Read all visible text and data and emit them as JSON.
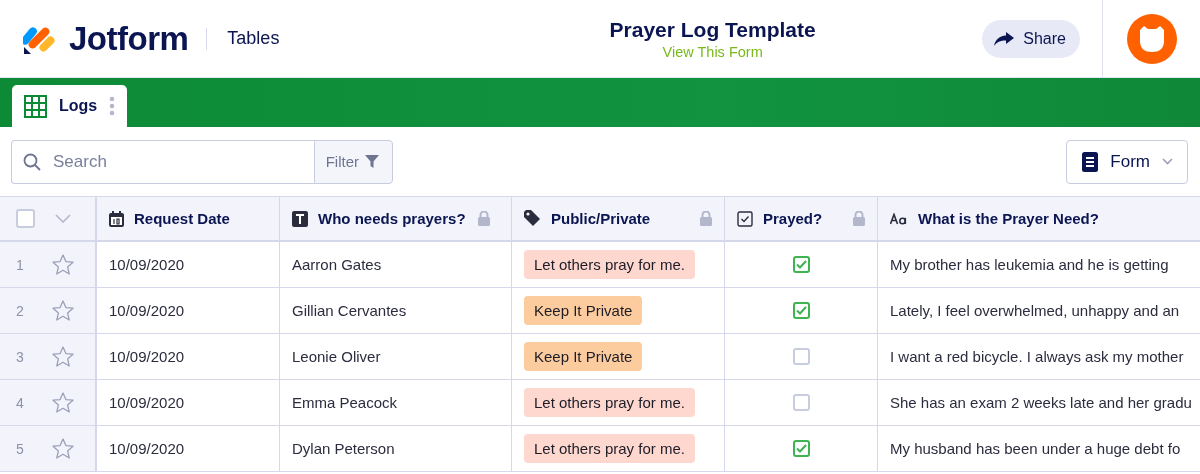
{
  "header": {
    "brand": "Jotform",
    "section": "Tables",
    "title": "Prayer Log Template",
    "form_link": "View This Form",
    "share": "Share"
  },
  "tabs": [
    {
      "label": "Logs",
      "selected": true
    }
  ],
  "toolbar": {
    "search_placeholder": "Search",
    "filter": "Filter",
    "view": "Form"
  },
  "table": {
    "select_all_checked": false,
    "columns": [
      {
        "label": "Request Date",
        "kind": "date",
        "locked": false
      },
      {
        "label": "Who needs prayers?",
        "kind": "text",
        "locked": true
      },
      {
        "label": "Public/Private",
        "kind": "tag",
        "locked": true
      },
      {
        "label": "Prayed?",
        "kind": "checkbox",
        "locked": true
      },
      {
        "label": "What is the Prayer Need?",
        "kind": "longtext",
        "locked": false
      }
    ],
    "rows": [
      {
        "number": "1",
        "starred": false,
        "date": "10/09/2020",
        "name": "Aarron Gates",
        "tag": "Let others pray for me.",
        "color": "#fed7cf",
        "prayed": true,
        "need": "My brother has leukemia and he is getting"
      },
      {
        "number": "2",
        "starred": false,
        "date": "10/09/2020",
        "name": "Gillian Cervantes",
        "tag": "Keep It Private",
        "color": "#fdcc9e",
        "prayed": true,
        "need": "Lately, I feel overwhelmed, unhappy and an"
      },
      {
        "number": "3",
        "starred": false,
        "date": "10/09/2020",
        "name": "Leonie Oliver",
        "tag": "Keep It Private",
        "color": "#fdcc9e",
        "prayed": false,
        "need": "I want a red bicycle. I always ask my mother"
      },
      {
        "number": "4",
        "starred": false,
        "date": "10/09/2020",
        "name": "Emma Peacock",
        "tag": "Let others pray for me.",
        "color": "#fed7cf",
        "prayed": false,
        "need": "She has an exam 2 weeks late and her gradu"
      },
      {
        "number": "5",
        "starred": false,
        "date": "10/09/2020",
        "name": "Dylan Peterson",
        "tag": "Let others pray for me.",
        "color": "#fed7cf",
        "prayed": true,
        "need": "My husband has been under a huge debt fo"
      }
    ]
  }
}
